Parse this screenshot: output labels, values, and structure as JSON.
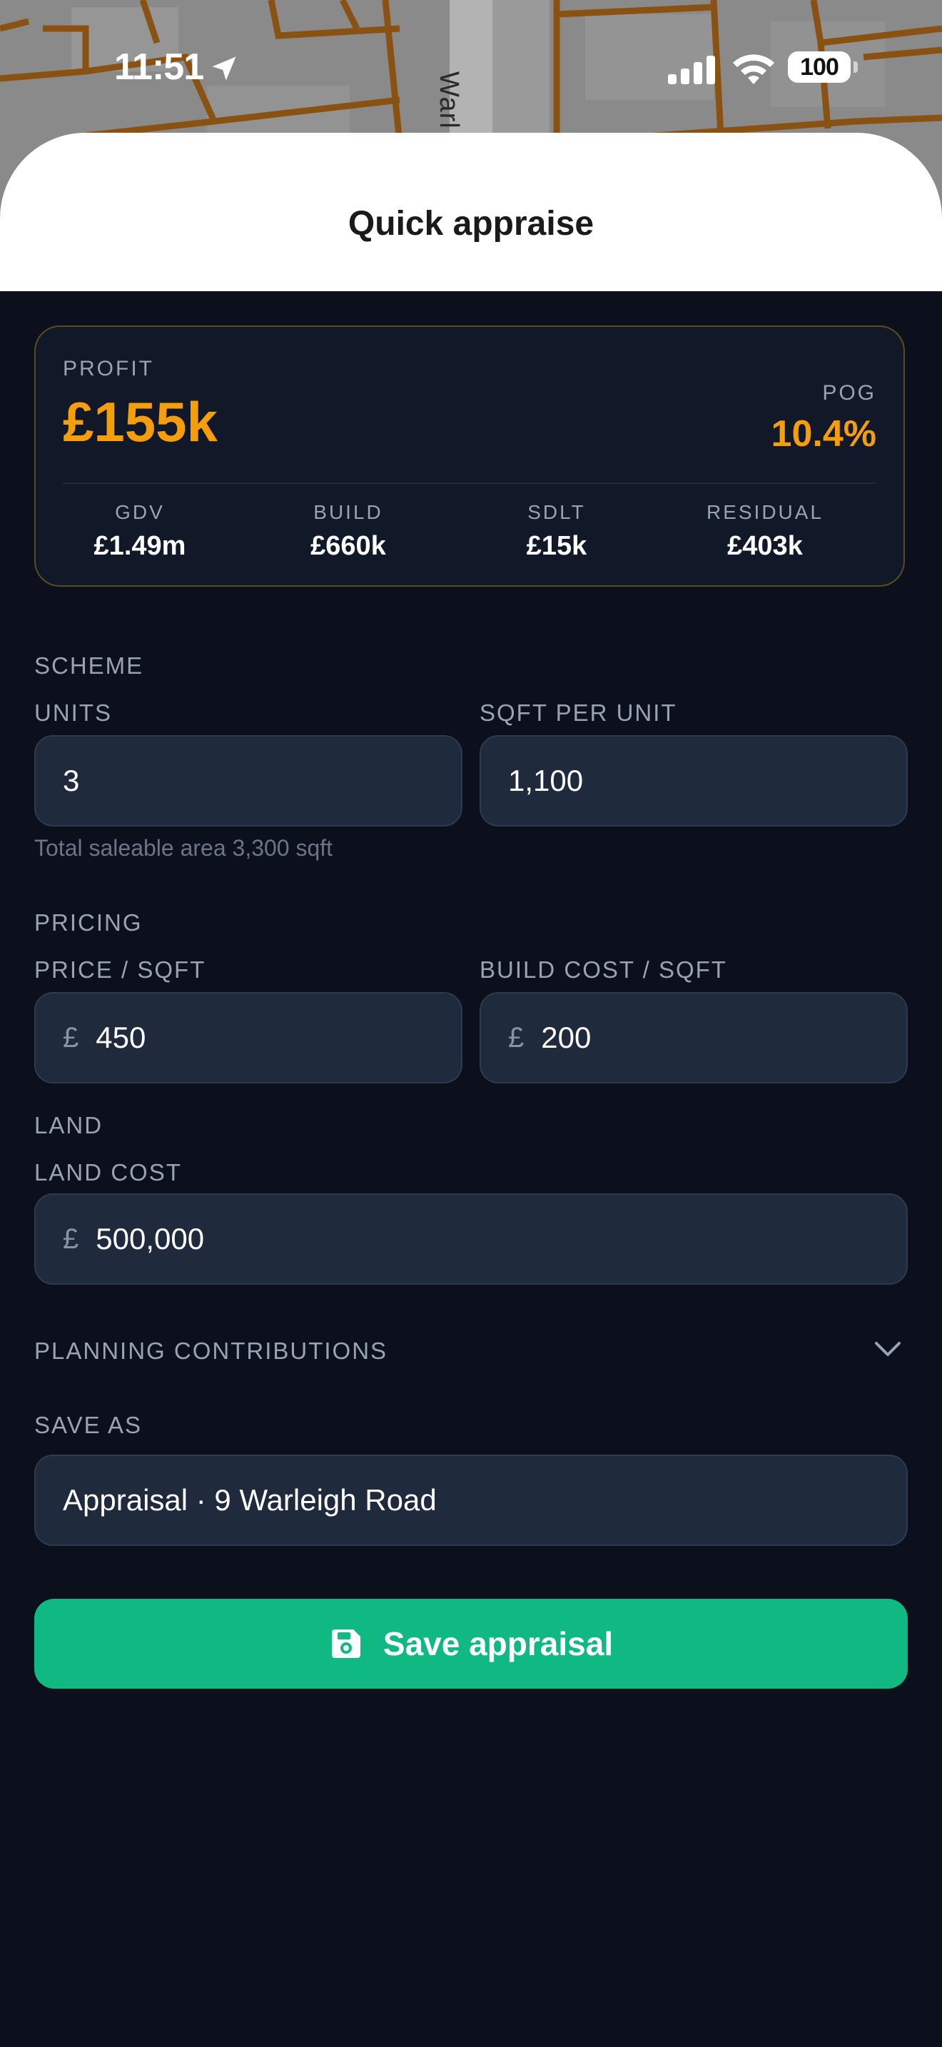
{
  "status_bar": {
    "time": "11:51",
    "battery": "100"
  },
  "map": {
    "road_label": "Warl"
  },
  "sheet": {
    "title": "Quick appraise"
  },
  "summary": {
    "profit_label": "PROFIT",
    "profit_value": "£155k",
    "pog_label": "POG",
    "pog_value": "10.4%",
    "metrics": [
      {
        "label": "GDV",
        "value": "£1.49m"
      },
      {
        "label": "BUILD",
        "value": "£660k"
      },
      {
        "label": "SDLT",
        "value": "£15k"
      },
      {
        "label": "RESIDUAL",
        "value": "£403k"
      }
    ]
  },
  "scheme": {
    "section": "SCHEME",
    "units_label": "UNITS",
    "units_value": "3",
    "sqft_label": "SQFT PER UNIT",
    "sqft_value": "1,100",
    "hint": "Total saleable area 3,300 sqft"
  },
  "pricing": {
    "section": "PRICING",
    "price_label": "PRICE / SQFT",
    "price_value": "450",
    "build_label": "BUILD COST / SQFT",
    "build_value": "200",
    "currency": "£"
  },
  "land": {
    "section": "LAND",
    "cost_label": "LAND COST",
    "cost_value": "500,000"
  },
  "planning": {
    "section": "PLANNING CONTRIBUTIONS"
  },
  "save_as": {
    "label": "SAVE AS",
    "value": "Appraisal · 9 Warleigh Road"
  },
  "actions": {
    "save_label": "Save appraisal"
  },
  "colors": {
    "accent_profit": "#f59e0b",
    "primary_button": "#10b981",
    "background": "#0b101c"
  },
  "icons": {
    "location": "location-arrow-icon",
    "signal": "cellular-signal-icon",
    "wifi": "wifi-icon",
    "chevron": "chevron-down-icon",
    "save": "floppy-disk-icon"
  }
}
